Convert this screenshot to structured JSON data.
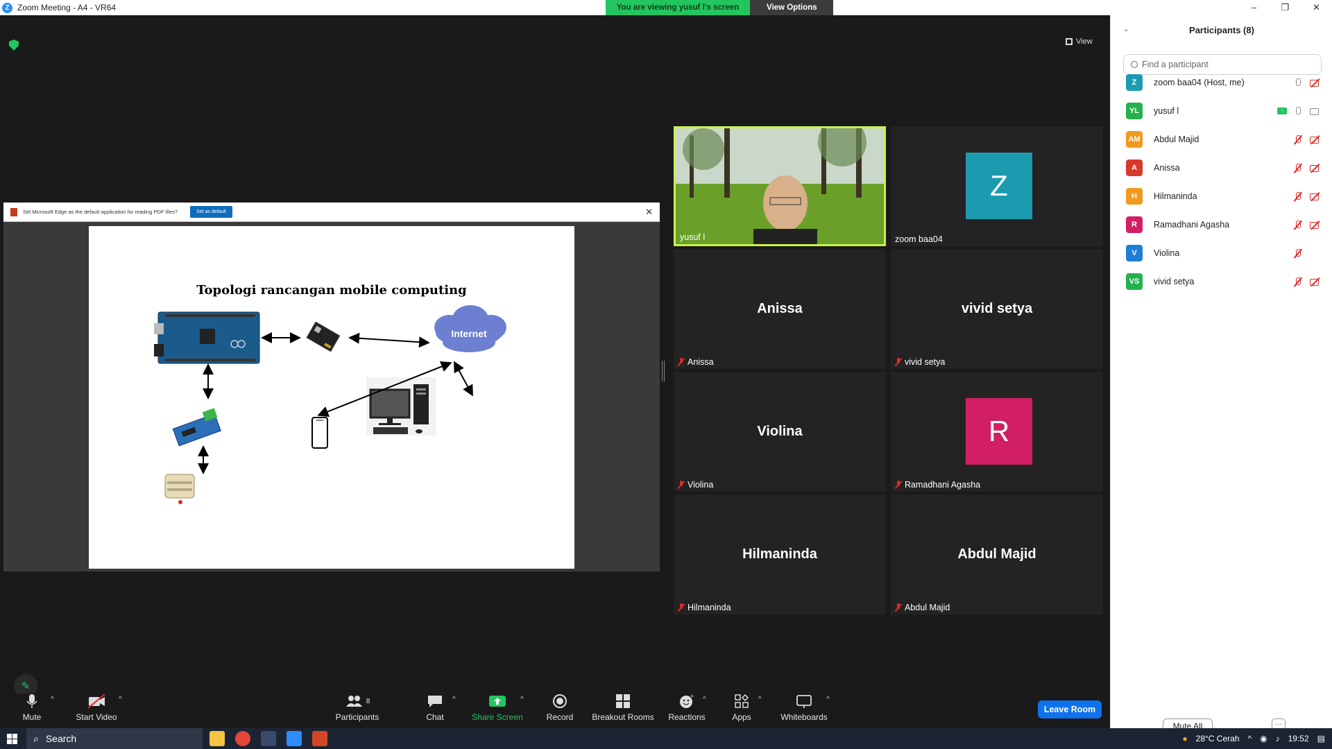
{
  "window": {
    "title": "Zoom Meeting - A4 - VR64",
    "controls": [
      "–",
      "❐",
      "✕"
    ]
  },
  "banner": {
    "viewing": "You are viewing yusuf l's screen",
    "options": "View Options",
    "options_caret": "⌄"
  },
  "view_button": "View",
  "shared": {
    "pdf_message": "Set Microsoft Edge as the default application for reading PDF files?",
    "set_default": "Set as default",
    "close": "✕",
    "slide_title": "Topologi rancangan mobile computing",
    "internet_label": "Internet"
  },
  "tiles": [
    {
      "id": "yusuf",
      "label": "yusuf l",
      "muted": false
    },
    {
      "id": "zoom",
      "label": "zoom baa04",
      "avatar_letter": "Z",
      "avatar_color": "#1c9bb0",
      "muted": false
    },
    {
      "id": "anissa",
      "big": "Anissa",
      "label": "Anissa",
      "muted": true
    },
    {
      "id": "vivid",
      "big": "vivid setya",
      "label": "vivid setya",
      "muted": true
    },
    {
      "id": "violina",
      "big": "Violina",
      "label": "Violina",
      "muted": true
    },
    {
      "id": "ramadhani",
      "label": "Ramadhani Agasha",
      "avatar_letter": "R",
      "avatar_color": "#d21f63",
      "muted": true
    },
    {
      "id": "hilmaninda",
      "big": "Hilmaninda",
      "label": "Hilmaninda",
      "muted": true
    },
    {
      "id": "abdul",
      "big": "Abdul Majid",
      "label": "Abdul Majid",
      "muted": true
    }
  ],
  "toolbar": {
    "mute": "Mute",
    "start_video": "Start Video",
    "participants": "Participants",
    "participants_count": "8",
    "chat": "Chat",
    "share_screen": "Share Screen",
    "record": "Record",
    "breakout_rooms": "Breakout Rooms",
    "reactions": "Reactions",
    "apps": "Apps",
    "whiteboards": "Whiteboards",
    "leave_room": "Leave Room",
    "caret": "^"
  },
  "panel": {
    "title": "Participants (8)",
    "search_placeholder": "Find a participant",
    "mute_all": "Mute All",
    "more": "···",
    "participants": [
      {
        "initials": "Z",
        "name": "zoom baa04 (Host, me)",
        "color": "#1c9bb0",
        "mic": "on-gray",
        "cam": "off"
      },
      {
        "initials": "YL",
        "name": "yusuf l",
        "color": "#23b14d",
        "mic": "on-gray",
        "cam": "on",
        "sharing": true
      },
      {
        "initials": "AM",
        "name": "Abdul Majid",
        "color": "#f39a1e",
        "mic": "off",
        "cam": "off"
      },
      {
        "initials": "A",
        "name": "Anissa",
        "color": "#d63a2b",
        "mic": "off",
        "cam": "off"
      },
      {
        "initials": "H",
        "name": "Hilmaninda",
        "color": "#f39a1e",
        "mic": "off",
        "cam": "off"
      },
      {
        "initials": "R",
        "name": "Ramadhani Agasha",
        "color": "#d21f63",
        "mic": "off",
        "cam": "off"
      },
      {
        "initials": "V",
        "name": "Violina",
        "color": "#1e7fd6",
        "mic": "off",
        "cam": "none"
      },
      {
        "initials": "VS",
        "name": "vivid setya",
        "color": "#23b14d",
        "mic": "off",
        "cam": "off"
      }
    ]
  },
  "taskbar": {
    "search": "Search",
    "weather": "28°C Cerah",
    "time": "19:52"
  },
  "colors": {
    "accent_blue": "#0e72ed",
    "green": "#23c55e",
    "muted_red": "#e02828",
    "speaker_border": "#c8f24a"
  }
}
